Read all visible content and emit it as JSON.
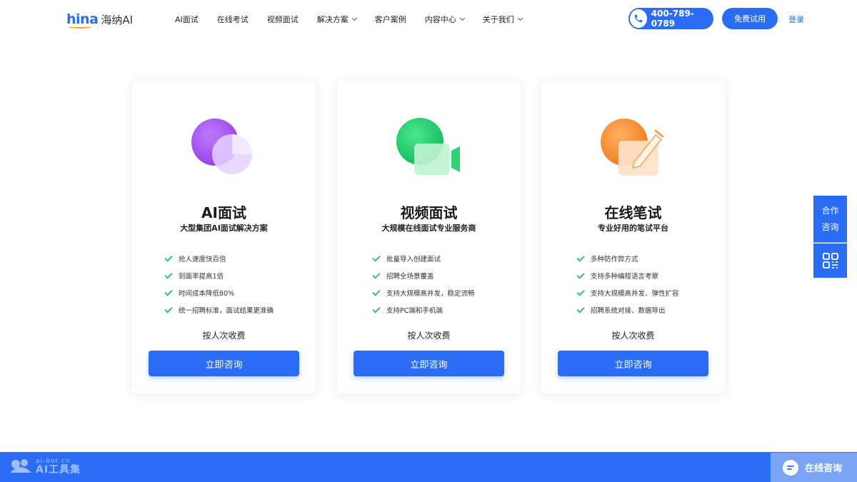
{
  "header": {
    "logo_mark": "hina",
    "logo_text": "海纳AI",
    "nav": [
      {
        "label": "AI面试",
        "dropdown": false
      },
      {
        "label": "在线考试",
        "dropdown": false
      },
      {
        "label": "视频面试",
        "dropdown": false
      },
      {
        "label": "解决方案",
        "dropdown": true
      },
      {
        "label": "客户案例",
        "dropdown": false
      },
      {
        "label": "内容中心",
        "dropdown": true
      },
      {
        "label": "关于我们",
        "dropdown": true
      }
    ],
    "phone": "400-789-0789",
    "trial_label": "免费试用",
    "login_label": "登录"
  },
  "cards": [
    {
      "title": "AI面试",
      "subtitle": "大型集团AI面试解决方案",
      "features": [
        "抢人速度快百倍",
        "到面率提高1倍",
        "时间成本降低80%",
        "统一招聘标准，面试结果更准确"
      ],
      "price": "按人次收费",
      "button": "立即咨询",
      "icon": "ai-interview-icon"
    },
    {
      "title": "视频面试",
      "subtitle": "大规模在线面试专业服务商",
      "features": [
        "批量导入创建面试",
        "招聘全场景覆盖",
        "支持大规模高并发，稳定流畅",
        "支持PC端和手机端"
      ],
      "price": "按人次收费",
      "button": "立即咨询",
      "icon": "video-camera-icon"
    },
    {
      "title": "在线笔试",
      "subtitle": "专业好用的笔试平台",
      "features": [
        "多种防作弊方式",
        "支持多种编程语言考察",
        "支持大规模高并发、弹性扩容",
        "招聘系统对接、数据导出"
      ],
      "price": "按人次收费",
      "button": "立即咨询",
      "icon": "pen-exam-icon"
    }
  ],
  "side": {
    "coop_line1": "合作",
    "coop_line2": "咨询"
  },
  "footer": {
    "watermark_small": "ai-bot.cn",
    "watermark_big": "AI工具集",
    "online_chat": "在线咨询"
  },
  "colors": {
    "primary": "#2a6df4",
    "check": "#2ec27e",
    "purple": "#a34ff0",
    "green": "#20c66a",
    "orange": "#f5892a"
  }
}
